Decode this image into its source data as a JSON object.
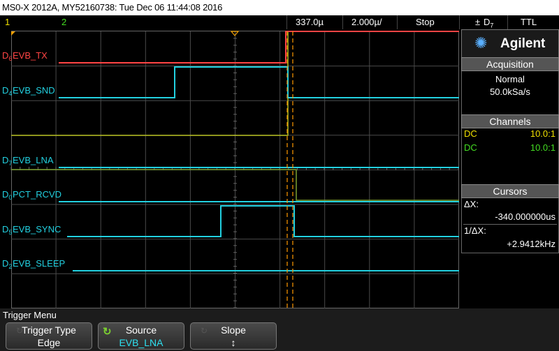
{
  "window": {
    "title": "MS0-X 2012A, MY52160738: Tue Dec 06 11:44:08 2016"
  },
  "topbar": {
    "ch1": "1",
    "ch2": "2",
    "trigger_position": "337.0µ",
    "time_per_div": "2.000µ/",
    "run_state": "Stop",
    "trigger_symbol": "±",
    "trigger_source": "D7",
    "logic_level": "TTL"
  },
  "colors": {
    "grid": "#4a4a4a",
    "digital": "#22d0e0",
    "tx": "#ff4444",
    "cursor": "#ff9900",
    "overlay": "#b8c020"
  },
  "signals": [
    {
      "id": "D6",
      "label": "EVB_TX",
      "channel": "D6",
      "color": "#ff4444",
      "label_color": "#ff4444"
    },
    {
      "id": "D4",
      "label": "EVB_SND",
      "channel": "D4",
      "color": "#22d0e0",
      "label_color": "#22d0e0"
    },
    {
      "id": "D7",
      "label": "EVB_LNA",
      "channel": "D7",
      "color": "#22d0e0",
      "label_color": "#22d0e0"
    },
    {
      "id": "D0",
      "label": "PCT_RCVD",
      "channel": "D0",
      "color": "#22d0e0",
      "label_color": "#22d0e0"
    },
    {
      "id": "D5",
      "label": "EVB_SYNC",
      "channel": "D5",
      "color": "#22d0e0",
      "label_color": "#22d0e0"
    },
    {
      "id": "D2",
      "label": "EVB_SLEEP",
      "channel": "D2",
      "color": "#22d0e0",
      "label_color": "#22d0e0"
    }
  ],
  "sidebar": {
    "brand": "Agilent",
    "acquisition": {
      "header": "Acquisition",
      "mode": "Normal",
      "rate": "50.0kSa/s"
    },
    "channels": {
      "header": "Channels",
      "rows": [
        {
          "coupling": "DC",
          "probe": "10.0:1",
          "color": "#f0e000"
        },
        {
          "coupling": "DC",
          "probe": "10.0:1",
          "color": "#44dd22"
        }
      ]
    },
    "cursors": {
      "header": "Cursors",
      "dx_label": "ΔX:",
      "dx_value": "-340.000000us",
      "inv_label": "1/ΔX:",
      "inv_value": "+2.9412kHz"
    }
  },
  "bottom": {
    "menu_title": "Trigger Menu",
    "softkeys": [
      {
        "line1": "Trigger Type",
        "line2": "Edge"
      },
      {
        "line1": "Source",
        "line2": "EVB_LNA"
      },
      {
        "line1": "Slope",
        "line2": "↕"
      }
    ]
  }
}
